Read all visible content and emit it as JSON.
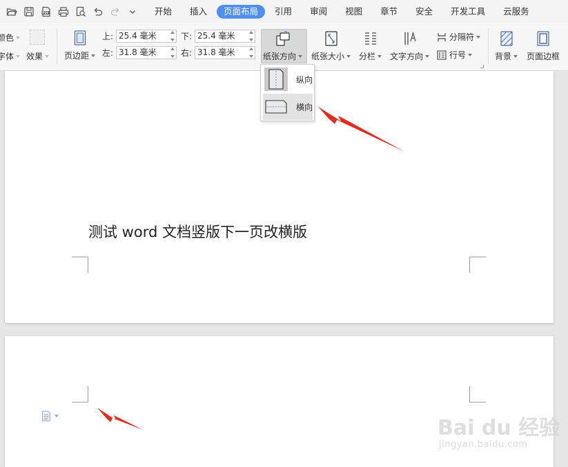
{
  "menubar": {
    "quick_icons": [
      "open-icon",
      "save-icon",
      "pdf-icon",
      "print-icon",
      "print-preview-icon",
      "undo-icon",
      "redo-icon",
      "more-icon"
    ],
    "tabs": [
      {
        "label": "开始",
        "active": false
      },
      {
        "label": "插入",
        "active": false
      },
      {
        "label": "页面布局",
        "active": true
      },
      {
        "label": "引用",
        "active": false
      },
      {
        "label": "审阅",
        "active": false
      },
      {
        "label": "视图",
        "active": false
      },
      {
        "label": "章节",
        "active": false
      },
      {
        "label": "安全",
        "active": false
      },
      {
        "label": "开发工具",
        "active": false
      },
      {
        "label": "云服务",
        "active": false
      }
    ],
    "accent_color": "#4f8ff0"
  },
  "toolbar": {
    "theme_color_label": "颜色",
    "theme_font_label": "字体",
    "theme_effect_label": "效果",
    "margins_label": "页边距",
    "margin_top_label": "上:",
    "margin_top_value": "25.4 毫米",
    "margin_bottom_label": "下:",
    "margin_bottom_value": "25.4 毫米",
    "margin_left_label": "左:",
    "margin_left_value": "31.8 毫米",
    "margin_right_label": "右:",
    "margin_right_value": "31.8 毫米",
    "orientation_label": "纸张方向",
    "paper_size_label": "纸张大小",
    "columns_label": "分栏",
    "text_direction_label": "文字方向",
    "separator_label": "分隔符",
    "line_number_label": "行号",
    "background_label": "背景",
    "page_border_label": "页面边框"
  },
  "orientation_menu": {
    "items": [
      {
        "label": "纵向",
        "selected": false
      },
      {
        "label": "横向",
        "selected": true
      }
    ]
  },
  "document": {
    "page1_text": "测试 word 文档竖版下一页改横版"
  },
  "watermark": {
    "logo_text": "Bai du 经验",
    "url": "jingyan.baidu.com"
  },
  "annotation_color": "#e8291c"
}
